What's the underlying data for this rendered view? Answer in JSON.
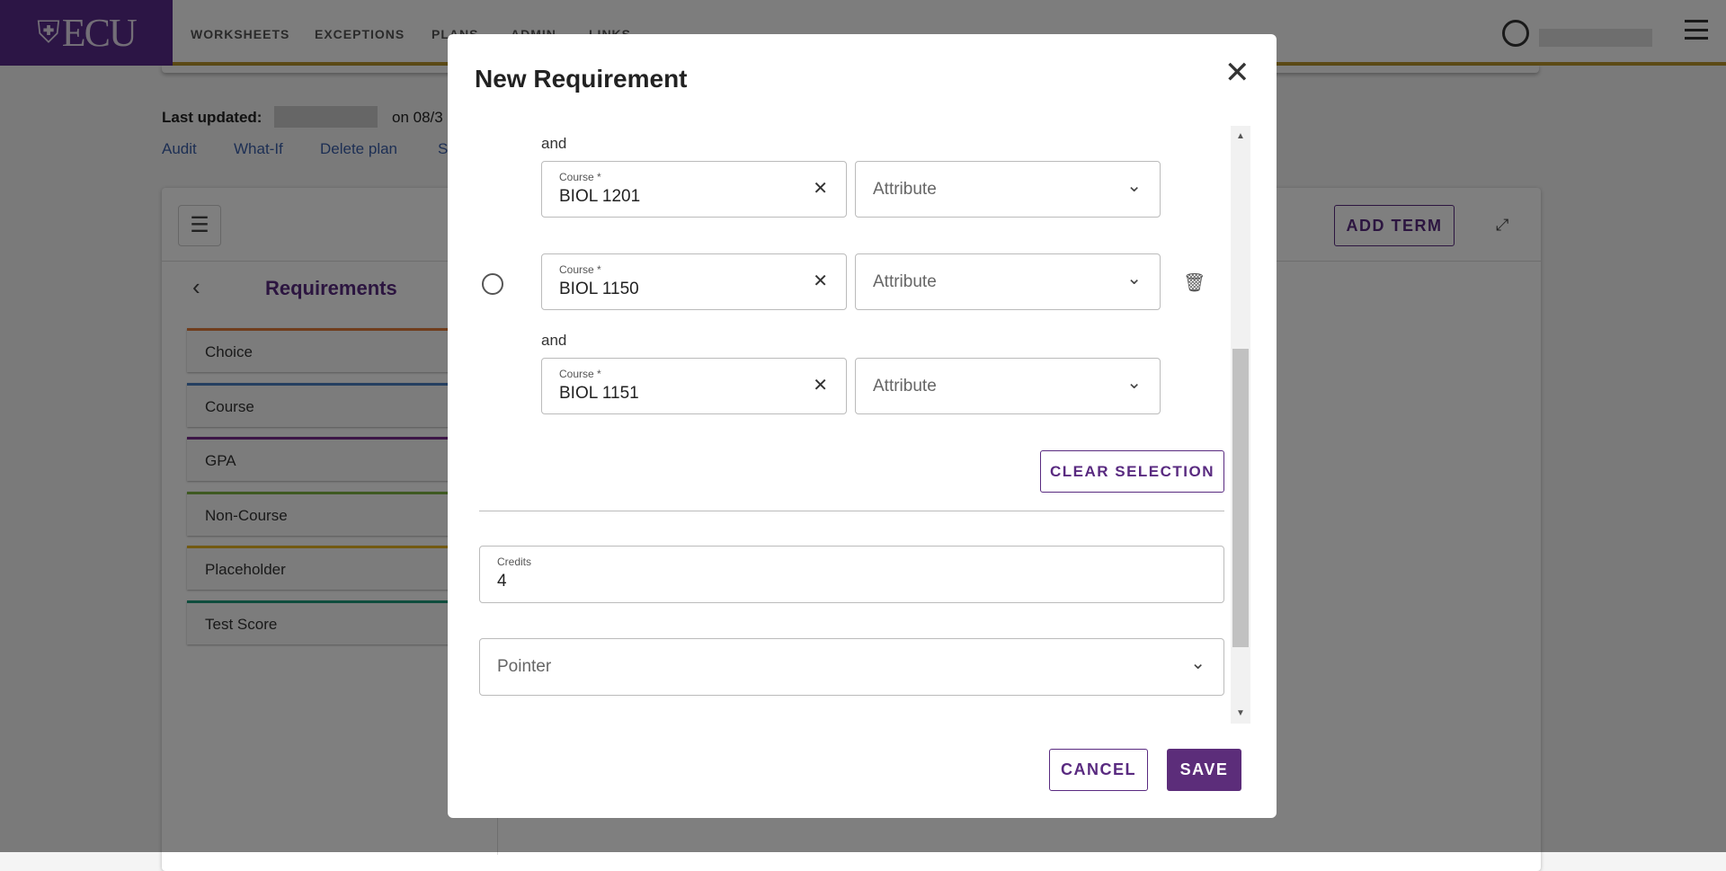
{
  "header": {
    "logo_text": "ECU",
    "nav": [
      "WORKSHEETS",
      "EXCEPTIONS",
      "PLANS",
      "ADMIN",
      "LINKS"
    ]
  },
  "page": {
    "last_updated_label": "Last updated:",
    "last_updated_suffix": "on 08/3",
    "links": [
      "Audit",
      "What-If",
      "Delete plan",
      "S"
    ]
  },
  "left_panel": {
    "title": "Requirements",
    "items": [
      {
        "label": "Choice",
        "color": "#e07b39"
      },
      {
        "label": "Course",
        "color": "#4a7fc1"
      },
      {
        "label": "GPA",
        "color": "#7b2d8e"
      },
      {
        "label": "Non-Course",
        "color": "#7cb342"
      },
      {
        "label": "Placeholder",
        "color": "#e6b422"
      },
      {
        "label": "Test Score",
        "color": "#1e9b7a"
      }
    ]
  },
  "toolbar": {
    "add_term": "ADD TERM"
  },
  "modal": {
    "title": "New Requirement",
    "and_label": "and",
    "rows": [
      {
        "course_label": "Course *",
        "course": "BIOL 1201",
        "attribute_placeholder": "Attribute"
      },
      {
        "course_label": "Course *",
        "course": "BIOL 1150",
        "attribute_placeholder": "Attribute"
      },
      {
        "course_label": "Course *",
        "course": "BIOL 1151",
        "attribute_placeholder": "Attribute"
      }
    ],
    "clear_selection": "CLEAR SELECTION",
    "credits_label": "Credits",
    "credits_value": "4",
    "pointer_placeholder": "Pointer",
    "cancel": "CANCEL",
    "save": "SAVE"
  },
  "colors": {
    "brand_purple": "#592a8a",
    "gold": "#b8952b"
  }
}
